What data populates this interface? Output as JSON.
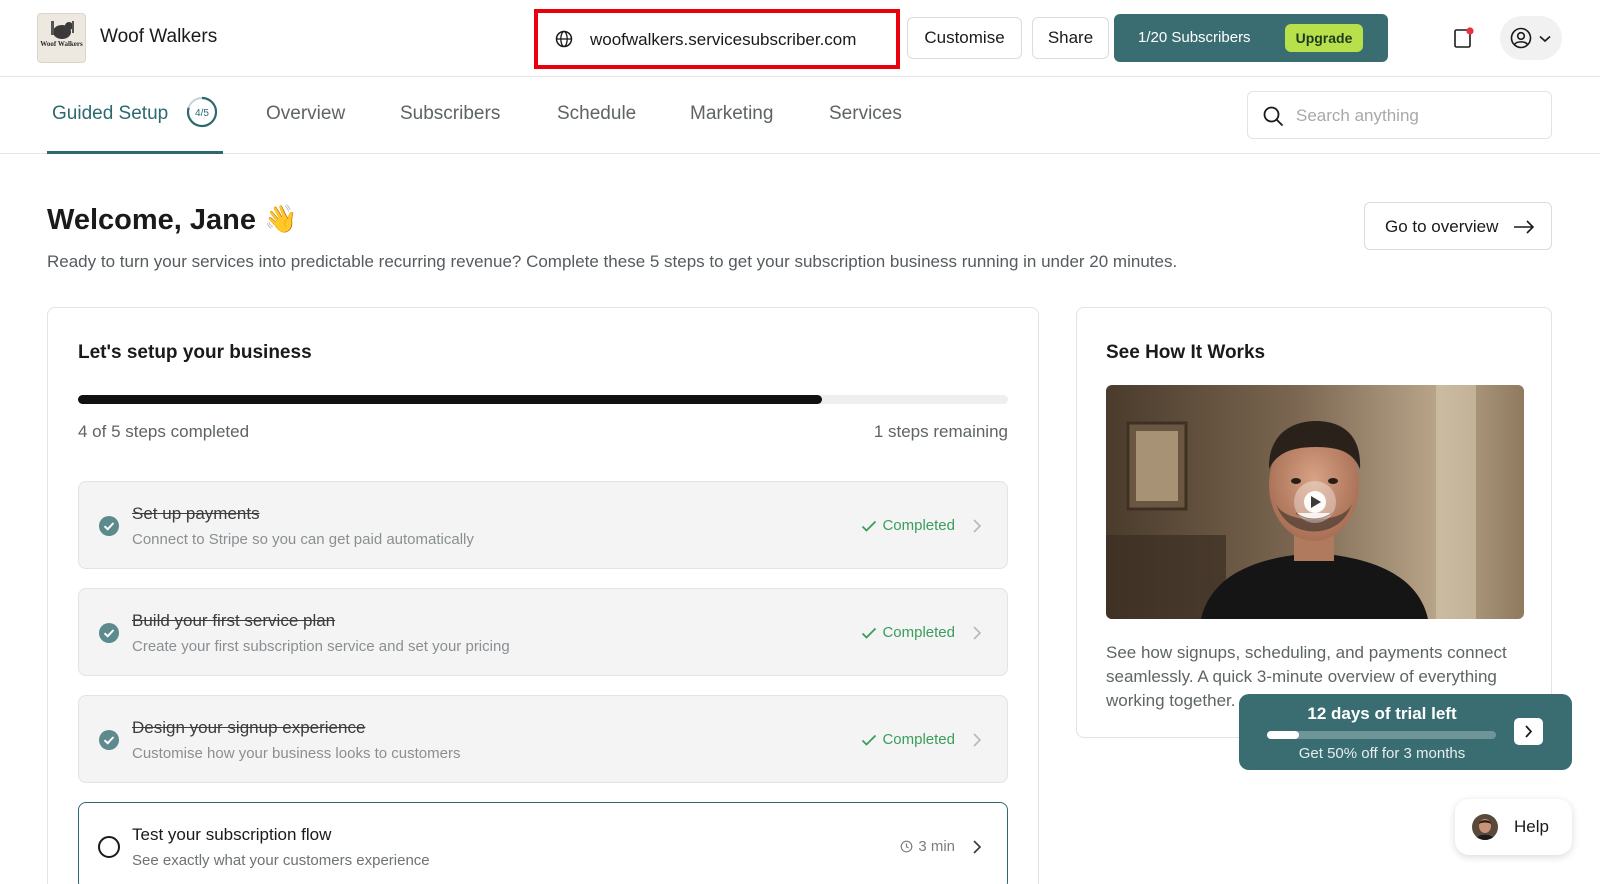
{
  "header": {
    "brand_logo_text": "Woof Walkers",
    "brand_name": "Woof Walkers",
    "domain": "woofwalkers.servicesubscriber.com",
    "customise_label": "Customise",
    "share_label": "Share",
    "subscribers_text": "1/20 Subscribers",
    "upgrade_label": "Upgrade",
    "icons": {
      "domain": "globe-icon",
      "notification": "bell-icon",
      "account": "user-circle-icon",
      "account_menu": "chevron-down-icon"
    },
    "notification_dot_color": "#e8323c"
  },
  "nav": {
    "tabs": [
      {
        "label": "Guided Setup",
        "badge": "4/5",
        "active": true
      },
      {
        "label": "Overview"
      },
      {
        "label": "Subscribers"
      },
      {
        "label": "Schedule"
      },
      {
        "label": "Marketing"
      },
      {
        "label": "Services"
      }
    ],
    "search_placeholder": "Search anything"
  },
  "welcome": {
    "title": "Welcome, Jane",
    "emoji": "👋",
    "subtitle": "Ready to turn your services into predictable recurring revenue? Complete these 5 steps to get your subscription business running in under 20 minutes.",
    "go_label": "Go to overview"
  },
  "setup": {
    "title": "Let's setup your business",
    "progress": 0.8,
    "steps_completed_text": "4 of 5 steps completed",
    "steps_remaining_text": "1 steps remaining",
    "steps": [
      {
        "title": "Set up payments",
        "desc": "Connect to Stripe so you can get paid automatically",
        "status": "Completed"
      },
      {
        "title": "Build your first service plan",
        "desc": "Create your first subscription service and set your pricing",
        "status": "Completed"
      },
      {
        "title": "Design your signup experience",
        "desc": "Customise how your business looks to customers",
        "status": "Completed"
      },
      {
        "title": "Test your subscription flow",
        "desc": "See exactly what your customers experience",
        "status": "3 min"
      }
    ]
  },
  "video": {
    "title": "See How It Works",
    "description": "See how signups, scheduling, and payments connect seamlessly. A quick 3-minute overview of everything working together."
  },
  "trial": {
    "title": "12 days of trial left",
    "subtitle": "Get 50% off for 3 months",
    "progress": 0.14
  },
  "help": {
    "label": "Help"
  },
  "colors": {
    "accent": "#2c6a70",
    "brand_bar": "#3a6d72",
    "upgrade": "#b8e04a",
    "completed_green": "#3a9d5d",
    "highlight_red": "#e8000d"
  }
}
